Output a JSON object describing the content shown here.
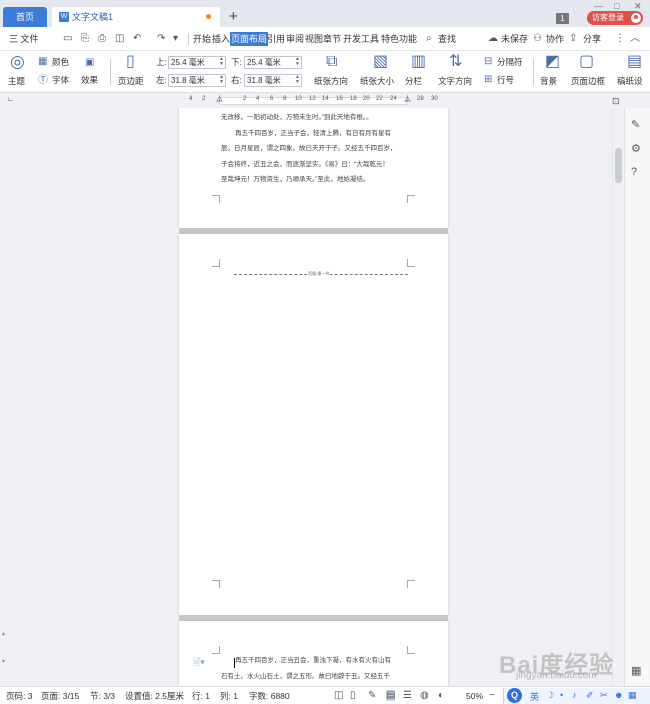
{
  "tabs": {
    "home": "首页",
    "doc_title": "文字文稿1",
    "doc_icon": "W",
    "plus": "+"
  },
  "window": {
    "badge": "1",
    "login": "访客登录",
    "minimize": "—",
    "maximize": "□",
    "close": "✕"
  },
  "menu": {
    "file": "三 文件",
    "items": [
      "开始",
      "插入",
      "页面布局",
      "引用",
      "审阅",
      "视图",
      "章节",
      "开发工具",
      "特色功能"
    ],
    "search": "查找",
    "unsaved": "未保存",
    "collab": "协作",
    "share": "分享"
  },
  "ribbon": {
    "theme": "主题",
    "color": "颜色",
    "font": "字体",
    "effect": "效果",
    "margins": "页边距",
    "top_label": "上:",
    "top_value": "25.4 毫米",
    "bottom_label": "下:",
    "bottom_value": "25.4 毫米",
    "left_label": "左:",
    "left_value": "31.8 毫米",
    "right_label": "右:",
    "right_value": "31.8 毫米",
    "orientation": "纸张方向",
    "size": "纸张大小",
    "columns": "分栏",
    "text_direction": "文字方向",
    "breaks": "分隔符",
    "line_numbers": "行号",
    "background": "背景",
    "page_border": "页面边框",
    "paper_more": "稿纸设"
  },
  "ruler": {
    "ticks": [
      "4",
      "2",
      "2",
      "4",
      "6",
      "8",
      "10",
      "12",
      "14",
      "16",
      "18",
      "20",
      "22",
      "24",
      "28",
      "30"
    ]
  },
  "page1": {
    "lines": [
      "无改移。一阳初动处，万物未生时。”到此天地有根。。",
      "再五千四百岁，正当子会，轻清上腾，有日有月有星有",
      "辰。日月星辰，谓之四象。故曰天开于子。又经五千四百岁，",
      "子会将终，近丑之会，而逐渐坚实。《易》曰：“大哉乾元！",
      "至哉坤元！万物资生，乃顺承天。”至此，地始凝结。"
    ]
  },
  "page2": {
    "header_label": "页眉-第一节"
  },
  "page3": {
    "lines": [
      "再五千四百岁，正当丑会，重浊下凝，有水有火有山有",
      "石有土。水火山石土，谓之五形。故曰地辟于丑。又经五千"
    ]
  },
  "statusbar": {
    "page_code": "页码: 3",
    "page": "页面: 3/15",
    "section": "节: 3/3",
    "setting": "设置值: 2.5厘米",
    "row": "行: 1",
    "col": "列: 1",
    "words": "字数: 6880",
    "zoom": "50%",
    "ime_lang": "英"
  },
  "watermark": {
    "main": "Bai度经验",
    "url": "jingyan.baidu.com"
  },
  "colors": {
    "accent": "#3d7bd9",
    "login": "#e0514a",
    "modified_dot": "#f08a24"
  }
}
